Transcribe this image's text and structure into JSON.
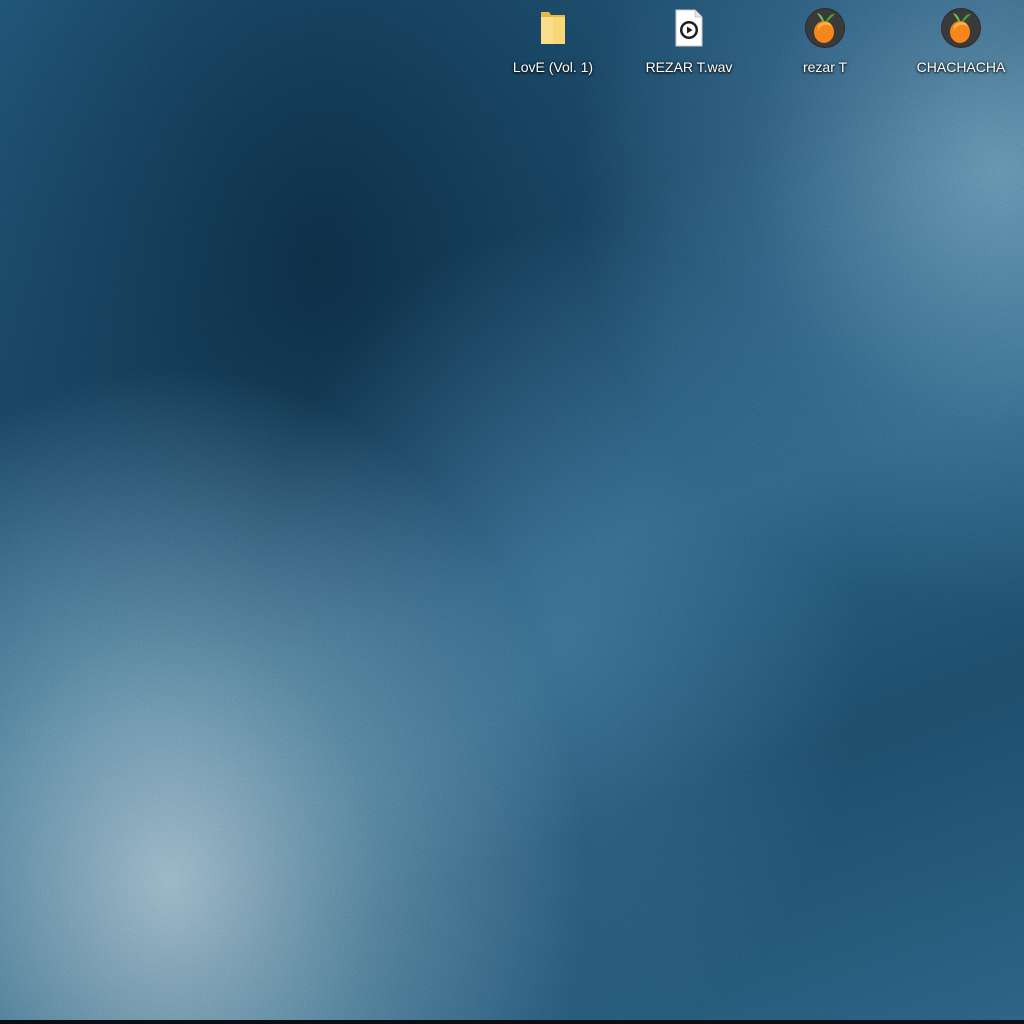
{
  "desktop": {
    "icons": [
      {
        "label": "LovE (Vol. 1)",
        "icon": "folder-icon"
      },
      {
        "label": "REZAR T.wav",
        "icon": "audio-file-icon"
      },
      {
        "label": "rezar T",
        "icon": "fl-studio-icon"
      },
      {
        "label": "CHACHACHA",
        "icon": "fl-studio-icon"
      }
    ]
  },
  "colors": {
    "folder": "#f6d46a",
    "fl_orange": "#f7861c",
    "fl_leaf": "#6cc24a"
  }
}
